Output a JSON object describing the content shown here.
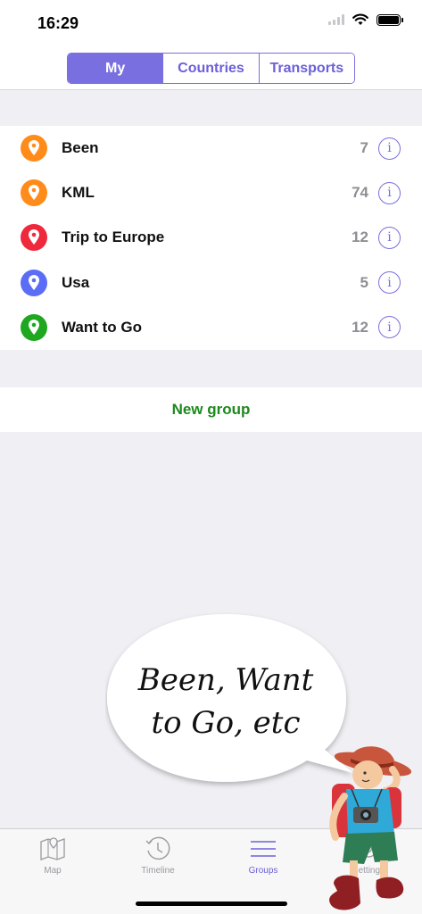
{
  "status_bar": {
    "time": "16:29"
  },
  "segmented": {
    "tabs": [
      "My",
      "Countries",
      "Transports"
    ],
    "active_index": 0
  },
  "groups": [
    {
      "name": "Been",
      "count": "7",
      "color": "#ff8c1a"
    },
    {
      "name": "KML",
      "count": "74",
      "color": "#ff8c1a"
    },
    {
      "name": "Trip to Europe",
      "count": "12",
      "color": "#f0283c"
    },
    {
      "name": "Usa",
      "count": "5",
      "color": "#5b6cf6"
    },
    {
      "name": "Want to Go",
      "count": "12",
      "color": "#1fa81f"
    }
  ],
  "info_glyph": "i",
  "new_group_label": "New group",
  "bubble": {
    "line1": "Been, Want",
    "line2": "to Go, etc"
  },
  "tab_bar": {
    "tabs": [
      {
        "label": "Map",
        "icon": "map-icon"
      },
      {
        "label": "Timeline",
        "icon": "clock-icon"
      },
      {
        "label": "Groups",
        "icon": "list-icon"
      },
      {
        "label": "Settings",
        "icon": "gear-icon"
      }
    ],
    "active_index": 2
  },
  "colors": {
    "accent": "#7a6fe0",
    "green": "#1c8a1c",
    "background": "#efeff4"
  }
}
